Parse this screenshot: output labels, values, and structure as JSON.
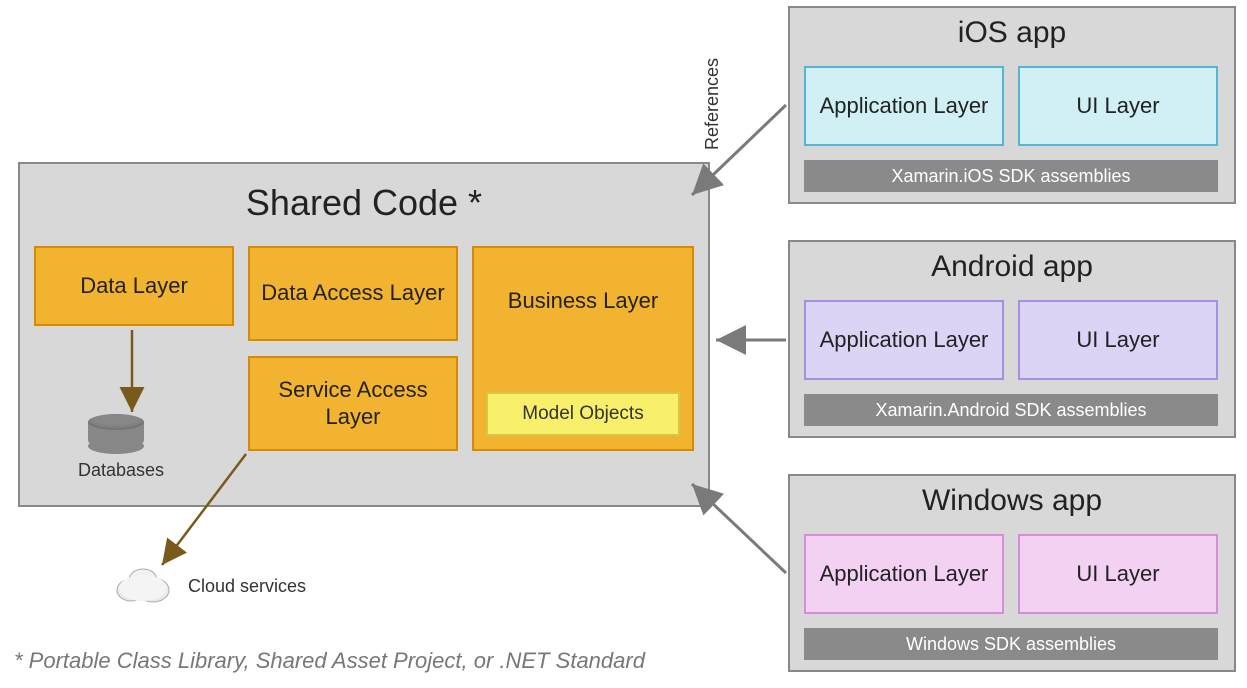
{
  "shared": {
    "title": "Shared Code *",
    "data_layer": "Data Layer",
    "data_access_layer": "Data Access Layer",
    "service_access_layer": "Service Access Layer",
    "business_layer": "Business Layer",
    "model_objects": "Model Objects",
    "databases_label": "Databases",
    "cloud_label": "Cloud services"
  },
  "ios": {
    "title": "iOS app",
    "app_layer": "Application Layer",
    "ui_layer": "UI Layer",
    "sdk": "Xamarin.iOS SDK assemblies"
  },
  "android": {
    "title": "Android app",
    "app_layer": "Application Layer",
    "ui_layer": "UI Layer",
    "sdk": "Xamarin.Android SDK assemblies"
  },
  "windows": {
    "title": "Windows app",
    "app_layer": "Application Layer",
    "ui_layer": "UI Layer",
    "sdk": "Windows SDK assemblies"
  },
  "references_label": "References",
  "footnote": "* Portable Class Library, Shared Asset Project, or .NET Standard",
  "colors": {
    "panel_bg": "#d8d8d8",
    "orange": "#f2b430",
    "yellow": "#f8f06a",
    "ios": "#d1f0f5",
    "android": "#dcd3f5",
    "windows": "#f3d1f3",
    "sdk_bar": "#8a8a8a"
  }
}
